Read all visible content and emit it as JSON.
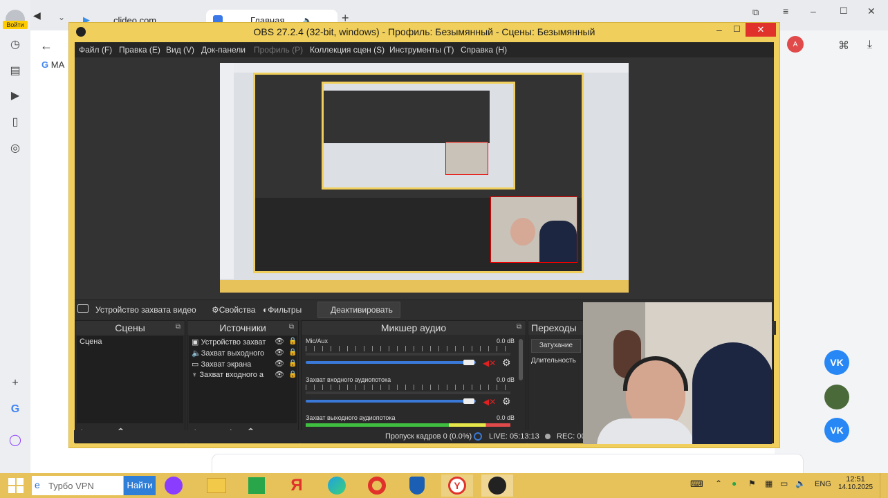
{
  "browser": {
    "login_label": "Войти",
    "tabs": [
      {
        "label": "clideo.com"
      },
      {
        "label": "Главная"
      }
    ],
    "new_tab_icon": "plus-icon",
    "bookmark_label": "MA"
  },
  "obs": {
    "title": "OBS 27.2.4 (32-bit, windows) - Профиль: Безымянный - Сцены: Безымянный",
    "menu": [
      "Файл (F)",
      "Правка (E)",
      "Вид (V)",
      "Док-панели",
      "Профиль (P)",
      "Коллекция сцен (S)",
      "Инструменты (T)",
      "Справка (H)"
    ],
    "toolbar": {
      "source_name": "Устройство захвата видео",
      "properties": "Свойства",
      "filters": "Фильтры",
      "deactivate": "Деактивировать"
    },
    "docks": {
      "scenes": {
        "title": "Сцены",
        "items": [
          "Сцена"
        ]
      },
      "sources": {
        "title": "Источники",
        "items": [
          "Устройство захват",
          "Захват выходного",
          "Захват экрана",
          "Захват входного а"
        ]
      },
      "mixer": {
        "title": "Микшер аудио",
        "channels": [
          {
            "name": "Mic/Aux",
            "db": "0.0 dB"
          },
          {
            "name": "Захват входного аудиопотока",
            "db": "0.0 dB"
          },
          {
            "name": "Захват выходного аудиопотока",
            "db": "0.0 dB"
          }
        ],
        "scale": [
          "-60",
          "-55",
          "-50",
          "-45",
          "-40",
          "-35",
          "-30",
          "-25",
          "-20",
          "-15",
          "-10",
          "-5",
          "0"
        ]
      },
      "transitions": {
        "title": "Переходы",
        "selected": "Затухание",
        "duration_label": "Длительность"
      }
    },
    "status": {
      "dropped": "Пропуск кадров 0 (0.0%)",
      "live": "LIVE: 05:13:13",
      "rec": "REC: 00"
    }
  },
  "taskbar": {
    "search_placeholder": "Турбо VPN",
    "search_button": "Найти",
    "lang": "ENG",
    "time": "12:51",
    "date": "14.10.2025"
  },
  "colors": {
    "obs_frame": "#f0cf5c",
    "taskbar": "#e7c25a",
    "obs_bg": "#2b2b2b",
    "slider": "#3a79d8",
    "mute": "#e02020"
  }
}
